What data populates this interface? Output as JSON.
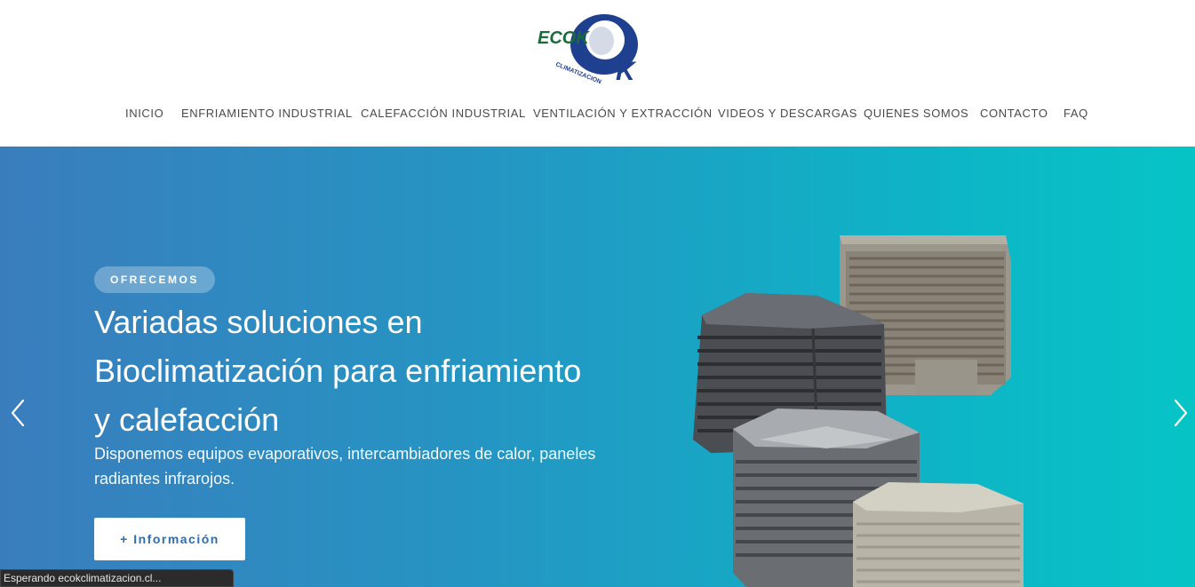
{
  "logo": {
    "brand": "ECOK",
    "letter": "K",
    "tagline": "CLIMATIZACION",
    "colors": {
      "green": "#1a6b3a",
      "blue": "#1f3f8f"
    }
  },
  "nav": {
    "items": [
      {
        "label": "INICIO"
      },
      {
        "label": "ENFRIAMIENTO INDUSTRIAL"
      },
      {
        "label": "CALEFACCIÓN INDUSTRIAL"
      },
      {
        "label": "VENTILACIÓN Y EXTRACCIÓN"
      },
      {
        "label": "VIDEOS Y DESCARGAS"
      },
      {
        "label": "QUIENES SOMOS"
      },
      {
        "label": "CONTACTO"
      },
      {
        "label": "FAQ"
      }
    ]
  },
  "hero": {
    "badge": "OFRECEMOS",
    "headline_lines": [
      "Variadas soluciones en",
      "Bioclimatización para enfriamiento",
      "y calefacción"
    ],
    "subtext_lines": [
      "Disponemos equipos evaporativos, intercambiadores de calor, paneles",
      "radiantes infrarojos."
    ],
    "cta_label": "+ Información",
    "prev_icon": "chevron-left-icon",
    "next_icon": "chevron-right-icon",
    "gradient": [
      "#3a7dbd",
      "#06c4c6"
    ]
  },
  "status": {
    "text": "Esperando ecokclimatizacion.cl..."
  }
}
